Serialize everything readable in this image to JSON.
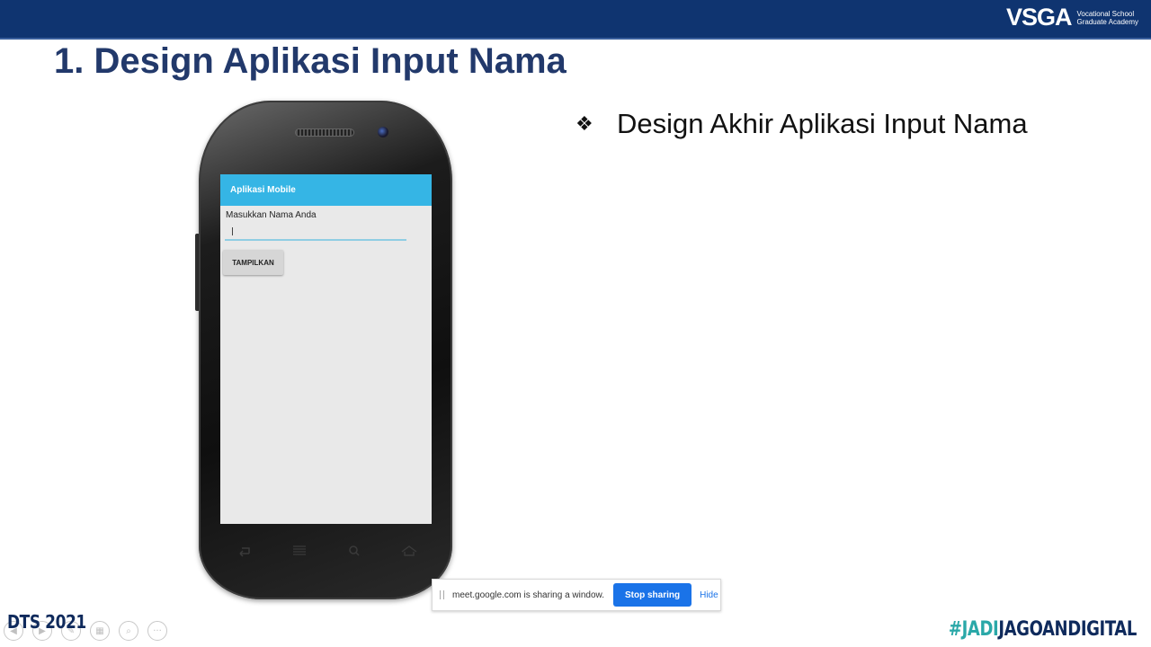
{
  "header": {
    "logo_mark": "VSGA",
    "logo_line1": "Vocational School",
    "logo_line2": "Graduate Academy"
  },
  "slide": {
    "title": "1. Design Aplikasi Input Nama",
    "bullet_glyph": "❖",
    "bullet_text": "Design Akhir Aplikasi Input Nama"
  },
  "phone_app": {
    "app_bar_title": "Aplikasi Mobile",
    "input_label": "Masukkan Nama Anda",
    "button_label": "TAMPILKAN"
  },
  "share_bar": {
    "message": "meet.google.com is sharing a window.",
    "stop_label": "Stop sharing",
    "hide_label": "Hide"
  },
  "footer": {
    "dts": "DTS 2021",
    "hashtag_part1": "#JADI",
    "hashtag_part2": "JAGOANDIGITAL",
    "controls": [
      "◀",
      "▶",
      "✎",
      "▦",
      "⌕",
      "···"
    ]
  }
}
